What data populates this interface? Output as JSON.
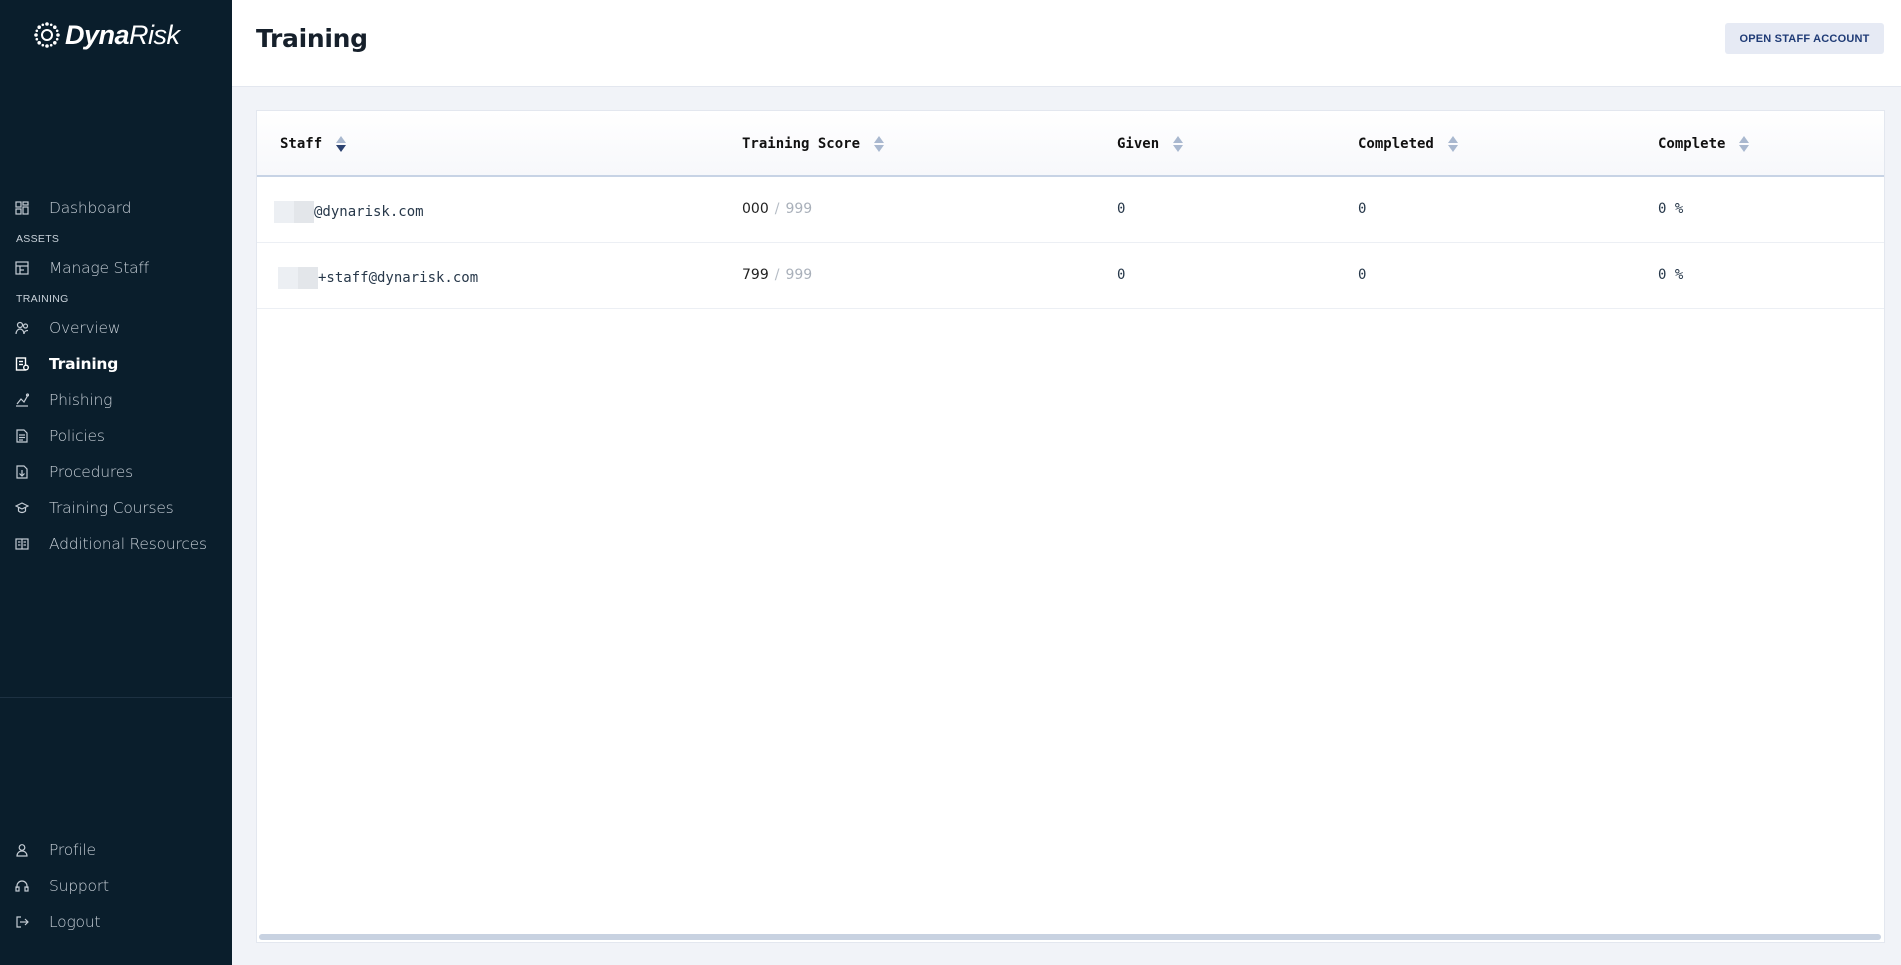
{
  "brand": {
    "name_bold": "Dyna",
    "name_light": "Risk"
  },
  "sidebar": {
    "dashboard": "Dashboard",
    "section_assets": "ASSETS",
    "manage_staff": "Manage Staff",
    "section_training": "TRAINING",
    "overview": "Overview",
    "training": "Training",
    "phishing": "Phishing",
    "policies": "Policies",
    "procedures": "Procedures",
    "training_courses": "Training Courses",
    "additional_resources": "Additional Resources",
    "profile": "Profile",
    "support": "Support",
    "logout": "Logout",
    "active_item": "Training"
  },
  "header": {
    "title": "Training",
    "open_staff_account": "OPEN STAFF ACCOUNT"
  },
  "table": {
    "columns": [
      "Staff",
      "Training Score",
      "Given",
      "Completed",
      "Complete"
    ],
    "sort_column": "Staff",
    "sort_direction": "descending",
    "rows": [
      {
        "staff": "@dynarisk.com",
        "score": "000",
        "score_sep": "/",
        "score_max": "999",
        "given": "0",
        "completed": "0",
        "complete": "0 %"
      },
      {
        "staff": "+staff@dynarisk.com",
        "score": "799",
        "score_sep": "/",
        "score_max": "999",
        "given": "0",
        "completed": "0",
        "complete": "0 %"
      }
    ]
  },
  "colors": {
    "sidebar_bg": "#0a1e2c",
    "page_bg": "#f1f3f8",
    "button_bg": "#e6eaf4",
    "button_text": "#1f3b76"
  }
}
